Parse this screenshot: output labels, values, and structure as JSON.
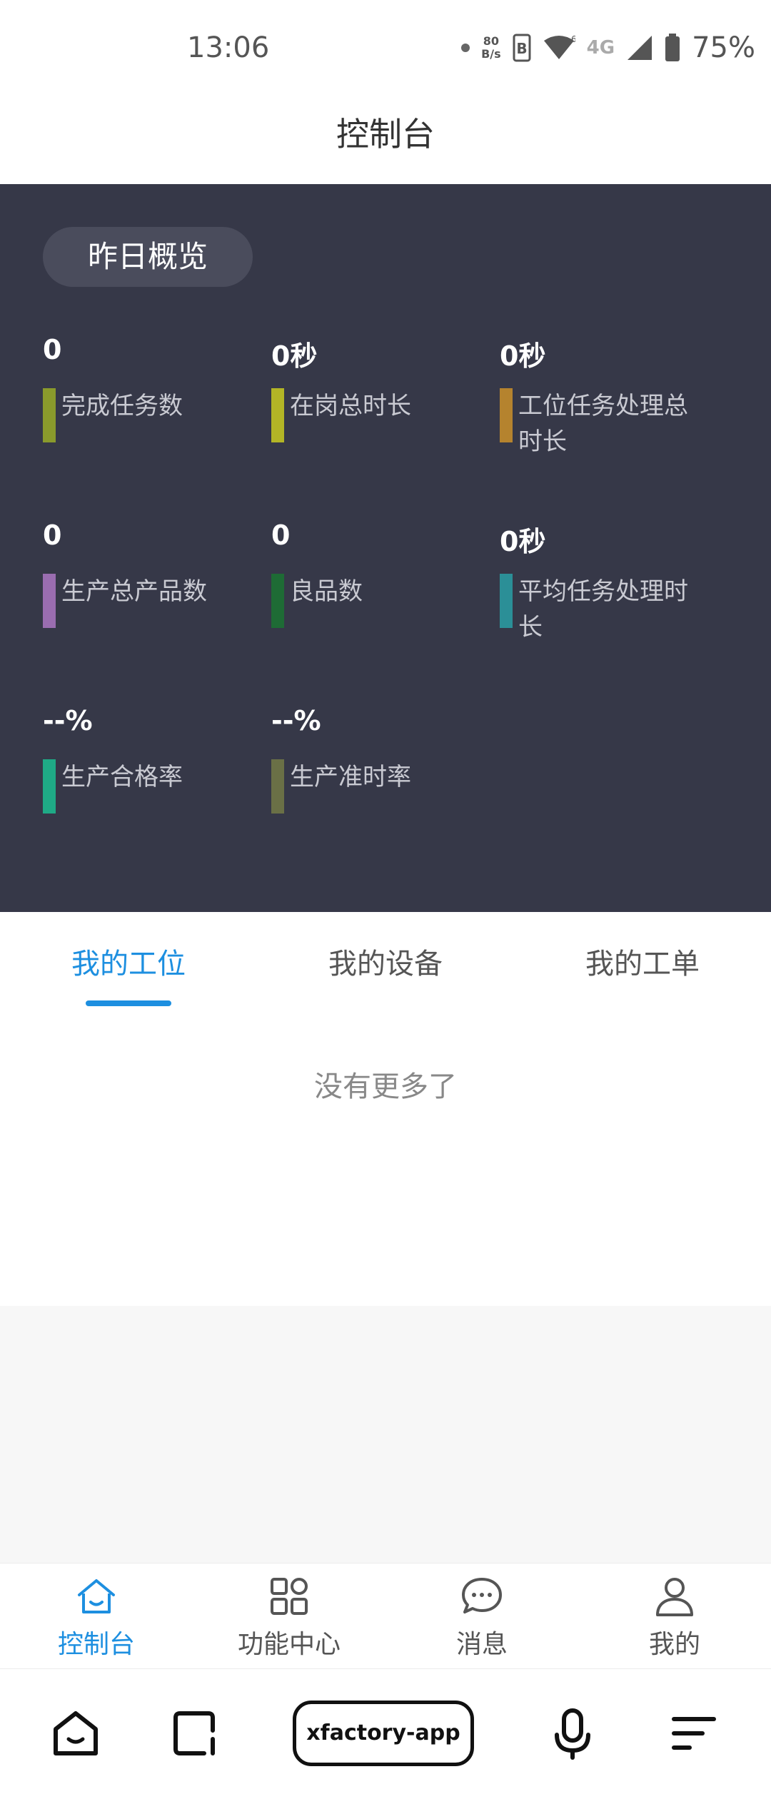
{
  "status_bar": {
    "time": "13:06",
    "net_speed_top": "80",
    "net_speed_bottom": "B/s",
    "network": "4G",
    "signal_badge": "6",
    "battery": "75%"
  },
  "header": {
    "title": "控制台"
  },
  "overview": {
    "chip_label": "昨日概览",
    "metrics": [
      {
        "value": "0",
        "label": "完成任务数",
        "color": "#8a9a2c"
      },
      {
        "value": "0秒",
        "label": "在岗总时长",
        "color": "#b3b526"
      },
      {
        "value": "0秒",
        "label": "工位任务处理总时长",
        "color": "#b5832e"
      },
      {
        "value": "0",
        "label": "生产总产品数",
        "color": "#9a6db0"
      },
      {
        "value": "0",
        "label": "良品数",
        "color": "#1e6b35"
      },
      {
        "value": "0秒",
        "label": "平均任务处理时长",
        "color": "#2b8f97"
      },
      {
        "value": "--%",
        "label": "生产合格率",
        "color": "#1faa86"
      },
      {
        "value": "--%",
        "label": "生产准时率",
        "color": "#6a7046"
      }
    ]
  },
  "tabs": [
    {
      "label": "我的工位",
      "active": true
    },
    {
      "label": "我的设备",
      "active": false
    },
    {
      "label": "我的工单",
      "active": false
    }
  ],
  "content": {
    "empty_text": "没有更多了"
  },
  "bottom_nav": {
    "items": [
      {
        "label": "控制台",
        "icon": "home-icon",
        "active": true
      },
      {
        "label": "功能中心",
        "icon": "grid-icon",
        "active": false
      },
      {
        "label": "消息",
        "icon": "chat-icon",
        "active": false
      },
      {
        "label": "我的",
        "icon": "user-icon",
        "active": false
      }
    ]
  },
  "system_nav": {
    "app_label": "xfactory-app"
  },
  "colors": {
    "accent": "#1d8fe0",
    "panel": "#363848"
  }
}
